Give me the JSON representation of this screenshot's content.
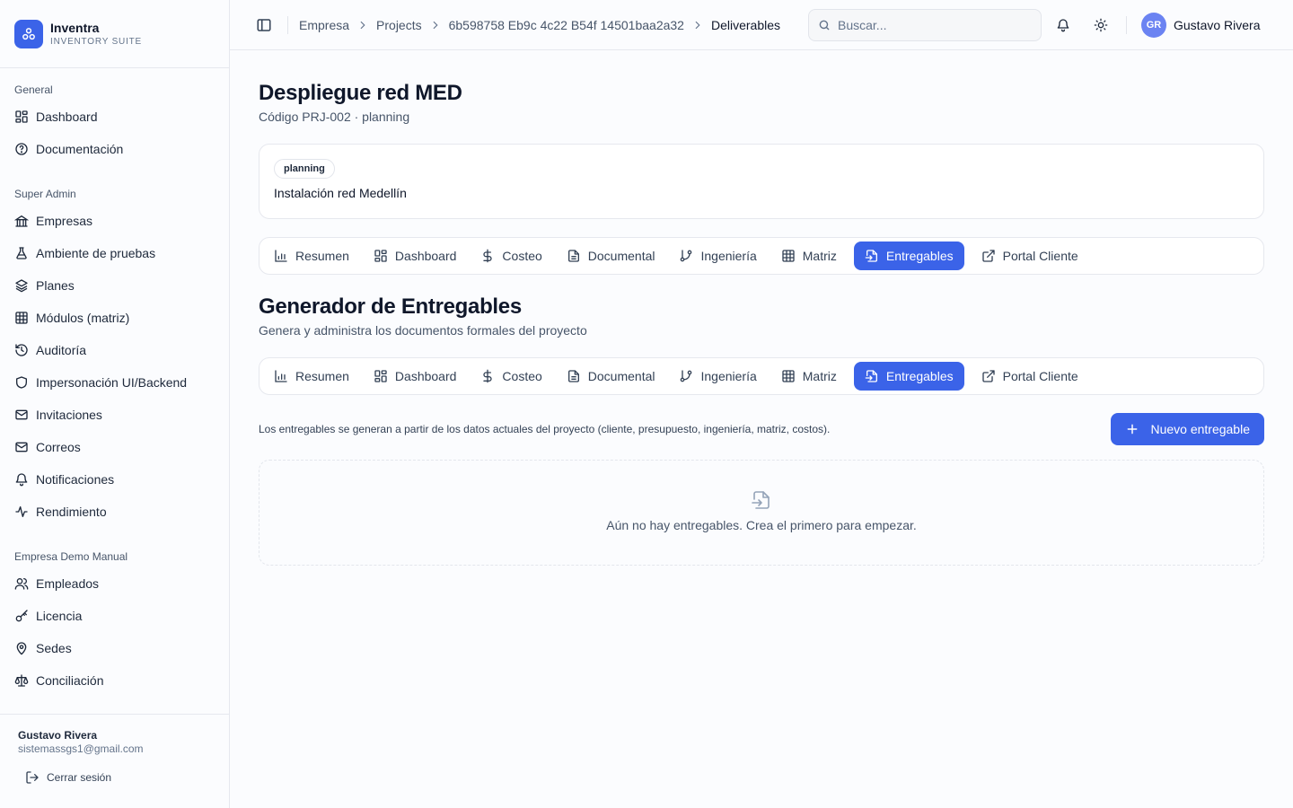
{
  "brand": {
    "name": "Inventra",
    "subtitle": "INVENTORY SUITE"
  },
  "sidebar": {
    "groups": [
      {
        "label": "General",
        "items": [
          {
            "label": "Dashboard",
            "icon": "grid-icon"
          },
          {
            "label": "Documentación",
            "icon": "help-circle-icon"
          }
        ]
      },
      {
        "label": "Super Admin",
        "items": [
          {
            "label": "Empresas",
            "icon": "library-icon"
          },
          {
            "label": "Ambiente de pruebas",
            "icon": "flask-icon"
          },
          {
            "label": "Planes",
            "icon": "layers-icon"
          },
          {
            "label": "Módulos (matriz)",
            "icon": "table-icon"
          },
          {
            "label": "Auditoría",
            "icon": "history-icon"
          },
          {
            "label": "Impersonación UI/Backend",
            "icon": "shield-icon"
          },
          {
            "label": "Invitaciones",
            "icon": "mail-icon"
          },
          {
            "label": "Correos",
            "icon": "mail-icon"
          },
          {
            "label": "Notificaciones",
            "icon": "bell-icon"
          },
          {
            "label": "Rendimiento",
            "icon": "activity-icon"
          }
        ]
      },
      {
        "label": "Empresa Demo Manual",
        "items": [
          {
            "label": "Empleados",
            "icon": "users-icon"
          },
          {
            "label": "Licencia",
            "icon": "key-icon"
          },
          {
            "label": "Sedes",
            "icon": "map-pin-icon"
          },
          {
            "label": "Conciliación",
            "icon": "scale-icon"
          }
        ]
      }
    ],
    "footer": {
      "user_name": "Gustavo Rivera",
      "user_email": "sistemassgs1@gmail.com",
      "logout_label": "Cerrar sesión"
    }
  },
  "header": {
    "breadcrumb": [
      "Empresa",
      "Projects",
      "6b598758 Eb9c 4c22 B54f 14501baa2a32",
      "Deliverables"
    ],
    "search": {
      "placeholder": "Buscar...",
      "value": ""
    },
    "user": {
      "initials": "GR",
      "name": "Gustavo Rivera"
    }
  },
  "project": {
    "title": "Despliegue red MED",
    "subtitle": "Código PRJ-002 · planning",
    "status_badge": "planning",
    "description": "Instalación red Medellín"
  },
  "tabs": [
    {
      "label": "Resumen",
      "icon": "bar-chart-icon",
      "active": false
    },
    {
      "label": "Dashboard",
      "icon": "layout-grid-icon",
      "active": false
    },
    {
      "label": "Costeo",
      "icon": "dollar-icon",
      "active": false
    },
    {
      "label": "Documental",
      "icon": "file-text-icon",
      "active": false
    },
    {
      "label": "Ingeniería",
      "icon": "git-branch-icon",
      "active": false
    },
    {
      "label": "Matriz",
      "icon": "table-icon",
      "active": false
    },
    {
      "label": "Entregables",
      "icon": "file-input-icon",
      "active": true
    },
    {
      "label": "Portal Cliente",
      "icon": "external-link-icon",
      "active": false
    }
  ],
  "deliverables": {
    "title": "Generador de Entregables",
    "subtitle": "Genera y administra los documentos formales del proyecto",
    "hint": "Los entregables se generan a partir de los datos actuales del proyecto (cliente, presupuesto, ingeniería, matriz, costos).",
    "new_button": "Nuevo entregable",
    "empty_text": "Aún no hay entregables. Crea el primero para empezar."
  },
  "colors": {
    "accent": "#3b63e8",
    "avatar": "#6b83f2"
  }
}
